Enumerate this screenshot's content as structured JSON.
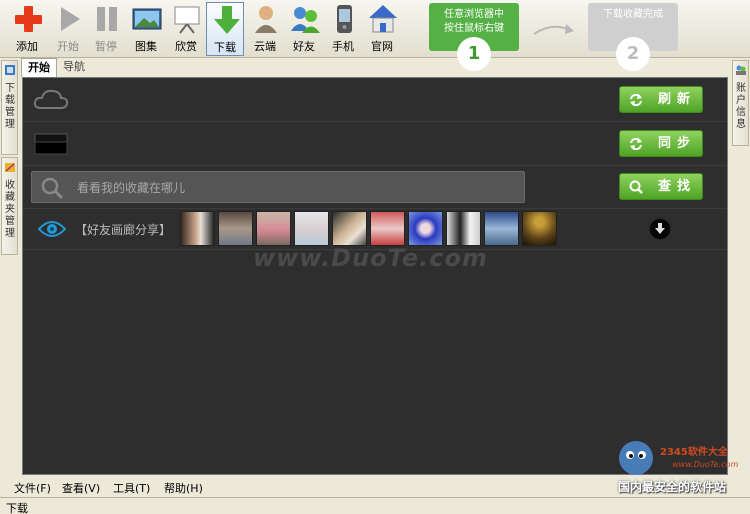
{
  "toolbar": {
    "buttons": [
      {
        "label": "添加",
        "icon": "add-icon"
      },
      {
        "label": "开始",
        "icon": "play-icon"
      },
      {
        "label": "暂停",
        "icon": "pause-icon"
      },
      {
        "label": "图集",
        "icon": "gallery-icon"
      },
      {
        "label": "欣赏",
        "icon": "slideshow-icon"
      },
      {
        "label": "下载",
        "icon": "download-icon"
      },
      {
        "label": "云端",
        "icon": "cloud-user-icon"
      },
      {
        "label": "好友",
        "icon": "friends-icon"
      },
      {
        "label": "手机",
        "icon": "phone-icon"
      },
      {
        "label": "官网",
        "icon": "home-icon"
      }
    ],
    "hint1": {
      "line1": "任意浏览器中",
      "line2": "按住鼠标右键",
      "num": "1"
    },
    "hint2": {
      "line1": "下载收藏完成",
      "num": "2"
    }
  },
  "tabs": [
    "开始",
    "导航"
  ],
  "left_panel": {
    "tab1": "下载管理",
    "tab2": "收藏夹管理"
  },
  "right_panel": {
    "tab1": "账户信息"
  },
  "main": {
    "refresh_label": "刷新",
    "sync_label": "同步",
    "search_label": "查找",
    "search_placeholder": "看看我的收藏在哪儿",
    "gallery_label": "【好友画廊分享】",
    "watermark": "www.DuoTe.com"
  },
  "menu": [
    "文件(F)",
    "查看(V)",
    "工具(T)",
    "帮助(H)"
  ],
  "brand": {
    "text": "国内最安全的软件站",
    "sub": "2345软件大全",
    "url": "www.DuoTe.com"
  },
  "status": "下载",
  "colors": {
    "accent_green": "#55b146",
    "panel_dark": "#2e2e2e"
  }
}
